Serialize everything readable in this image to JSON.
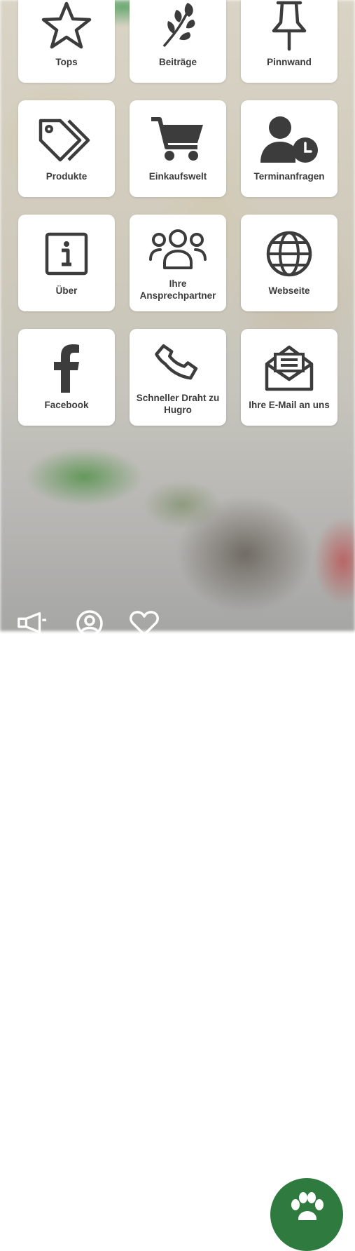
{
  "tiles": [
    {
      "label": "Tops",
      "icon": "star-icon"
    },
    {
      "label": "Beiträge",
      "icon": "leaf-icon"
    },
    {
      "label": "Pinnwand",
      "icon": "pushpin-icon"
    },
    {
      "label": "Produkte",
      "icon": "tags-icon"
    },
    {
      "label": "Einkaufswelt",
      "icon": "shopping-cart-icon"
    },
    {
      "label": "Terminanfragen",
      "icon": "user-clock-icon"
    },
    {
      "label": "Über",
      "icon": "info-icon"
    },
    {
      "label": "Ihre Ansprechpartner",
      "icon": "people-group-icon"
    },
    {
      "label": "Webseite",
      "icon": "globe-icon"
    },
    {
      "label": "Facebook",
      "icon": "facebook-icon"
    },
    {
      "label": "Schneller Draht zu Hugro",
      "icon": "phone-icon"
    },
    {
      "label": "Ihre E-Mail an uns",
      "icon": "open-envelope-icon"
    }
  ],
  "bottom_nav": {
    "icons": [
      "megaphone-icon",
      "profile-icon",
      "heart-icon"
    ],
    "fab_icon": "paw-icon",
    "fab_color": "#2f7a3e"
  }
}
